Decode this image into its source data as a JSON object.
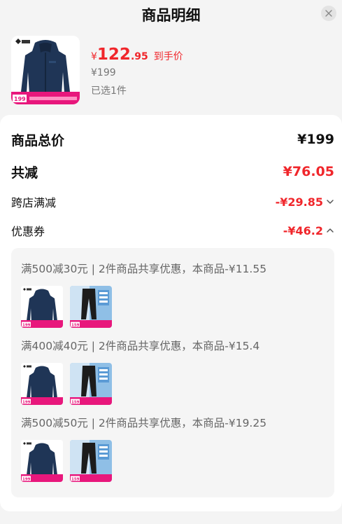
{
  "header": {
    "title": "商品明细"
  },
  "product": {
    "price_symbol": "¥",
    "price_int": "122",
    "price_dec": ".95",
    "price_tag": "到手价",
    "original_price": "¥199",
    "selected": "已选1件",
    "thumb_price": "199"
  },
  "summary": {
    "total_label": "商品总价",
    "total_value": "¥199",
    "discount_label": "共减",
    "discount_value": "¥76.05",
    "cross_label": "跨店满减",
    "cross_value": "-¥29.85",
    "coupon_label": "优惠券",
    "coupon_value": "-¥46.2"
  },
  "coupons": [
    {
      "text": "满500减30元 | 2件商品共享优惠，本商品-¥11.55"
    },
    {
      "text": "满400减40元 | 2件商品共享优惠，本商品-¥15.4"
    },
    {
      "text": "满500减50元 | 2件商品共享优惠，本商品-¥19.25"
    }
  ],
  "mini_labels": {
    "jacket_price": "199",
    "pants_price": "159"
  },
  "colors": {
    "accent": "#f0262b",
    "jacket": "#1f3556",
    "pink": "#e8177c",
    "pants_bg": "#8fbfe6"
  }
}
